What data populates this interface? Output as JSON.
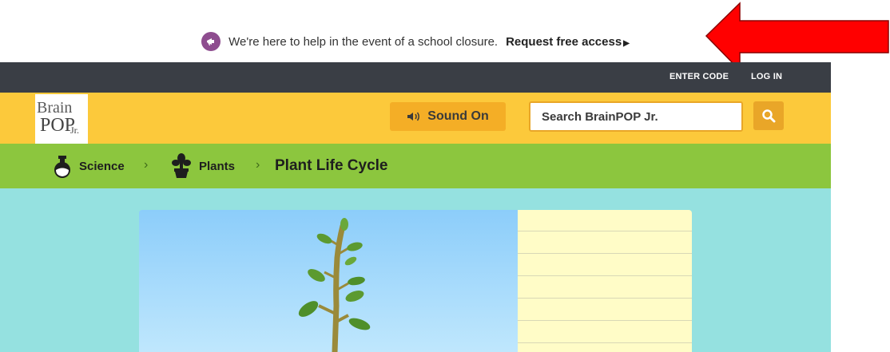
{
  "announcement": {
    "text": "We're here to help in the event of a school closure.",
    "link_label": "Request free access"
  },
  "topbar": {
    "enter_code": "ENTER CODE",
    "log_in": "LOG IN"
  },
  "header": {
    "logo_brain": "Brain",
    "logo_pop": "POP",
    "logo_jr": "Jr.",
    "sound_label": "Sound On",
    "search_placeholder": "Search BrainPOP Jr."
  },
  "breadcrumb": {
    "science": "Science",
    "plants": "Plants",
    "current": "Plant Life Cycle"
  },
  "colors": {
    "topbar": "#3a3e45",
    "header": "#fcc93b",
    "breadcrumb": "#8cc63e",
    "content": "#95e1e0",
    "arrow": "#ff0000",
    "megaphone": "#8e4d8f"
  },
  "icons": [
    "megaphone-icon",
    "speaker-icon",
    "search-icon",
    "flask-icon",
    "plant-icon",
    "chevron-right-icon",
    "red-arrow-icon"
  ]
}
